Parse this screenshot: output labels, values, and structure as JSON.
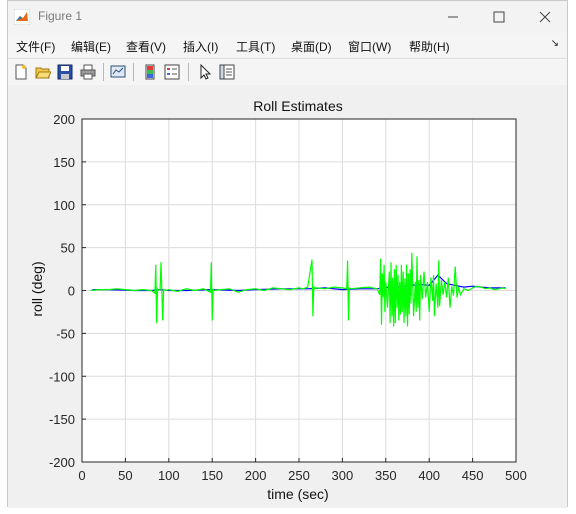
{
  "window": {
    "title": "Figure 1"
  },
  "menu": [
    {
      "label": "文件(F)"
    },
    {
      "label": "编辑(E)"
    },
    {
      "label": "查看(V)"
    },
    {
      "label": "插入(I)"
    },
    {
      "label": "工具(T)"
    },
    {
      "label": "桌面(D)"
    },
    {
      "label": "窗口(W)"
    },
    {
      "label": "帮助(H)"
    }
  ],
  "toolbar_icons": [
    "new-figure-icon",
    "open-file-icon",
    "save-icon",
    "print-icon",
    "print-preview-icon",
    "link-plot-icon",
    "insert-legend-icon",
    "select-arrow-icon",
    "property-inspector-icon"
  ],
  "colors": {
    "series_blue": "#0000ff",
    "series_green": "#00ff00",
    "grid": "#dcdcdc"
  },
  "chart_data": {
    "type": "line",
    "title": "Roll Estimates",
    "xlabel": "time (sec)",
    "ylabel": "roll (deg)",
    "xlim": [
      0,
      500
    ],
    "ylim": [
      -200,
      200
    ],
    "xticks": [
      0,
      50,
      100,
      150,
      200,
      250,
      300,
      350,
      400,
      450,
      500
    ],
    "yticks": [
      200,
      150,
      100,
      50,
      0,
      -50,
      -100,
      -150,
      -200
    ],
    "grid": true,
    "series": [
      {
        "color": "#0000ff",
        "x": [
          12,
          25,
          30,
          60,
          80,
          90,
          100,
          120,
          150,
          180,
          200,
          230,
          260,
          280,
          300,
          320,
          340,
          350,
          360,
          370,
          380,
          390,
          400,
          410,
          420,
          430,
          440,
          450,
          460,
          470,
          480,
          488
        ],
        "y": [
          1,
          1,
          1,
          0,
          0,
          1,
          0,
          0,
          1,
          0,
          1,
          2,
          2,
          3,
          1,
          2,
          2,
          4,
          3,
          5,
          6,
          7,
          6,
          18,
          8,
          6,
          4,
          5,
          4,
          3,
          3,
          3
        ]
      },
      {
        "color": "#00ff00",
        "x": [
          10,
          20,
          30,
          40,
          50,
          60,
          70,
          80,
          84,
          85,
          86,
          87,
          88,
          90,
          91,
          92,
          93,
          94,
          96,
          100,
          110,
          120,
          130,
          140,
          148,
          149,
          150,
          151,
          152,
          160,
          170,
          175,
          180,
          190,
          200,
          210,
          220,
          230,
          240,
          250,
          255,
          260,
          265,
          266,
          267,
          268,
          270,
          280,
          290,
          300,
          305,
          306,
          307,
          308,
          310,
          320,
          330,
          340,
          343,
          344,
          345,
          346,
          347,
          348,
          349,
          350,
          352,
          354,
          355,
          356,
          357,
          358,
          359,
          360,
          361,
          362,
          363,
          364,
          365,
          366,
          367,
          368,
          369,
          370,
          371,
          372,
          373,
          374,
          375,
          376,
          377,
          378,
          379,
          380,
          382,
          384,
          385,
          386,
          387,
          388,
          389,
          390,
          392,
          394,
          396,
          398,
          400,
          402,
          404,
          405,
          406,
          408,
          410,
          411,
          412,
          414,
          416,
          418,
          420,
          422,
          424,
          426,
          428,
          430,
          432,
          434,
          436,
          440,
          445,
          450,
          455,
          460,
          465,
          470,
          475,
          480,
          485,
          488
        ],
        "y": [
          0,
          1,
          1,
          2,
          1,
          0,
          1,
          0,
          -3,
          30,
          -38,
          2,
          0,
          1,
          33,
          -3,
          -35,
          1,
          0,
          1,
          -1,
          2,
          0,
          2,
          -2,
          33,
          -35,
          2,
          0,
          1,
          2,
          0,
          -2,
          1,
          2,
          0,
          3,
          2,
          1,
          3,
          2,
          4,
          36,
          -30,
          5,
          2,
          3,
          2,
          4,
          3,
          2,
          35,
          -35,
          3,
          2,
          3,
          4,
          2,
          -5,
          37,
          -40,
          20,
          -8,
          30,
          -25,
          10,
          -20,
          22,
          -38,
          33,
          -30,
          15,
          -42,
          25,
          -38,
          30,
          -20,
          18,
          -35,
          10,
          -28,
          30,
          -25,
          22,
          -38,
          14,
          -30,
          30,
          -42,
          20,
          -28,
          25,
          -15,
          44,
          -30,
          10,
          -25,
          40,
          -20,
          12,
          -35,
          18,
          -10,
          22,
          -8,
          10,
          -25,
          15,
          -12,
          18,
          -30,
          8,
          -20,
          35,
          -18,
          12,
          -5,
          10,
          -8,
          15,
          -20,
          5,
          -6,
          28,
          -8,
          4,
          -5,
          2,
          0,
          3,
          5,
          4,
          2,
          3,
          1,
          2,
          3,
          2
        ]
      }
    ]
  }
}
